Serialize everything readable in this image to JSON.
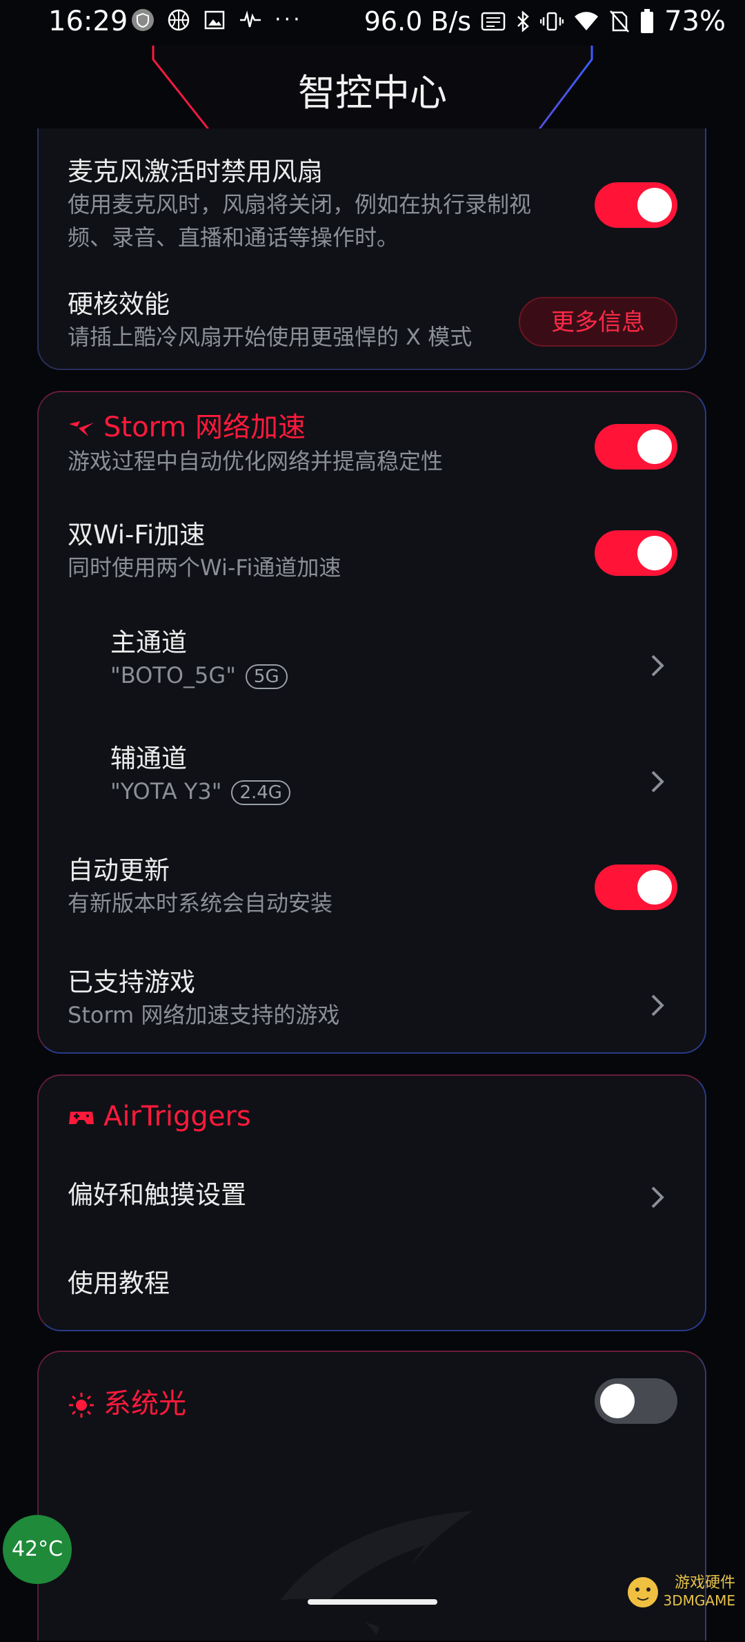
{
  "status_bar": {
    "time": "16:29",
    "net_speed": "96.0 B/s",
    "battery": "73%",
    "icons_left": [
      "shield-app-icon",
      "basketball-icon",
      "image-icon",
      "waveform-icon",
      "more-dots-icon"
    ],
    "icons_right": [
      "auto-hz-icon",
      "bluetooth-icon",
      "vibrate-icon",
      "wifi-icon",
      "no-sim-icon",
      "battery-icon"
    ]
  },
  "header": {
    "title": "智控中心"
  },
  "fan_card": {
    "mic_fan": {
      "title": "麦克风激活时禁用风扇",
      "subtitle": "使用麦克风时，风扇将关闭，例如在执行录制视频、录音、直播和通话等操作时。",
      "enabled": true
    },
    "hardcore": {
      "title": "硬核效能",
      "subtitle": "请插上酷冷风扇开始使用更强悍的 X 模式",
      "button": "更多信息"
    }
  },
  "storm_card": {
    "title": "Storm 网络加速",
    "subtitle": "游戏过程中自动优化网络并提高稳定性",
    "enabled": true,
    "dual_wifi": {
      "title": "双Wi-Fi加速",
      "subtitle": "同时使用两个Wi-Fi通道加速",
      "enabled": true
    },
    "primary": {
      "title": "主通道",
      "ssid": "\"BOTO_5G\"",
      "band": "5G"
    },
    "secondary": {
      "title": "辅通道",
      "ssid": "\"YOTA Y3\"",
      "band": "2.4G"
    },
    "auto_update": {
      "title": "自动更新",
      "subtitle": "有新版本时系统会自动安装",
      "enabled": true
    },
    "supported": {
      "title": "已支持游戏",
      "subtitle": "Storm 网络加速支持的游戏"
    }
  },
  "airtriggers_card": {
    "title": "AirTriggers",
    "prefs": "偏好和触摸设置",
    "tutorial": "使用教程"
  },
  "light_card": {
    "title": "系统光",
    "enabled": false
  },
  "temperature": "42°C",
  "watermark": {
    "line1": "游戏硬件",
    "line2": "3DMGAME"
  },
  "colors": {
    "accent": "#ff1438",
    "card": "#0f1116",
    "background": "#05070b"
  }
}
